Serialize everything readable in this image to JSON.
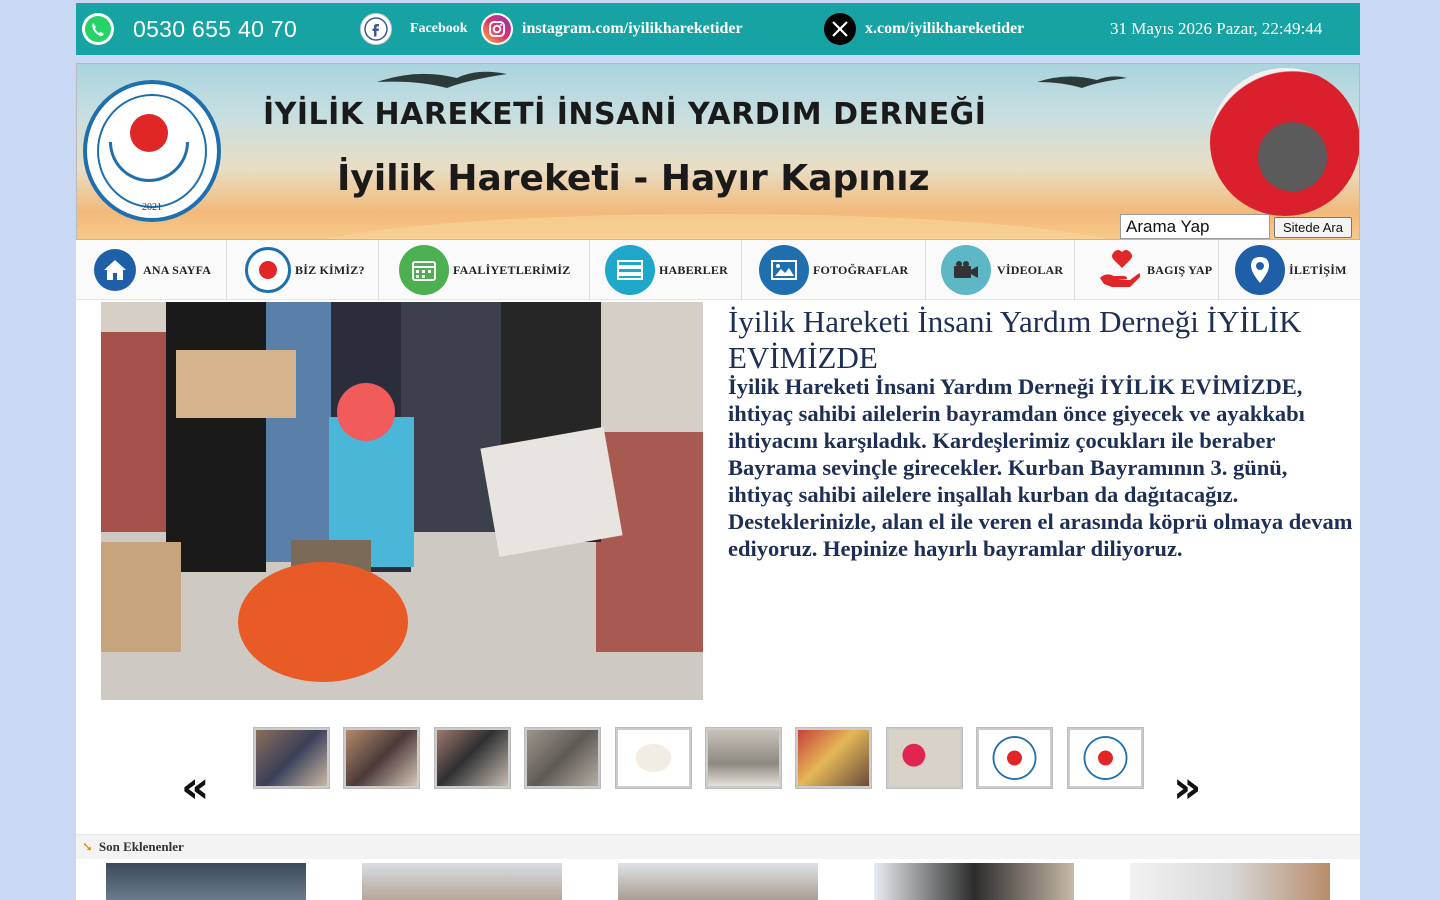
{
  "topbar": {
    "phone": "0530 655 40 70",
    "facebook_label": "Facebook",
    "instagram_label": "instagram.com/iyilikhareketider",
    "x_label": "x.com/iyilikhareketider",
    "datetime": "31 Mayıs 2026 Pazar, 22:49:44",
    "icons": [
      "whatsapp-icon",
      "facebook-icon",
      "instagram-icon",
      "x-icon"
    ]
  },
  "banner": {
    "title": "İYİLİK HAREKETİ İNSANİ YARDIM DERNEĞİ",
    "subtitle": "İyilik Hareketi - Hayır Kapınız",
    "logo_year": "2021"
  },
  "search": {
    "placeholder": "Arama Yap",
    "value": "Arama Yap",
    "button_label": "Sitede Ara"
  },
  "nav": {
    "items": [
      {
        "label": "ANA SAYFA",
        "icon": "home-icon",
        "color": "#1f5fa8"
      },
      {
        "label": "BİZ KİMİZ?",
        "icon": "logo-icon",
        "color": "#ffffff"
      },
      {
        "label": "FAALİYETLERİMİZ",
        "icon": "calendar-icon",
        "color": "#4caf50"
      },
      {
        "label": "HABERLER",
        "icon": "news-icon",
        "color": "#1fa7c9"
      },
      {
        "label": "FOTOĞRAFLAR",
        "icon": "photo-icon",
        "color": "#1f6fb0"
      },
      {
        "label": "VİDEOLAR",
        "icon": "video-icon",
        "color": "#5eb7c4"
      },
      {
        "label": "BAGIŞ YAP",
        "icon": "donate-icon",
        "color": "#e02626"
      },
      {
        "label": "İLETİŞİM",
        "icon": "location-icon",
        "color": "#1f5fa8"
      }
    ]
  },
  "article": {
    "title": "İyilik Hareketi İnsani Yardım Derneği İYİLİK EVİMİZDE",
    "body": " İyilik Hareketi İnsani Yardım Derneği İYİLİK EVİMİZDE, ihtiyaç sahibi ailelerin bayramdan önce giyecek ve ayakkabı ihtiyacını karşıladık. Kardeşlerimiz çocukları ile beraber Bayrama sevinçle girecekler. Kurban Bayramının 3. günü, ihtiyaç sahibi ailelere inşallah kurban da dağıtacağız. Desteklerinizle, alan el ile veren el arasında köprü olmaya devam ediyoruz. Hepinize hayırlı bayramlar diliyoruz."
  },
  "slider": {
    "prev_icon": "double-chevron-left-icon",
    "next_icon": "double-chevron-right-icon",
    "prev_glyph": "«",
    "next_glyph": "»",
    "thumb_count": 10
  },
  "recent": {
    "label": "Son Eklenenler",
    "icon": "arrow-down-right-icon"
  },
  "colors": {
    "topbar": "#17a3a3",
    "text_primary": "#1e2f55",
    "page_bg": "#c9d9f3"
  }
}
